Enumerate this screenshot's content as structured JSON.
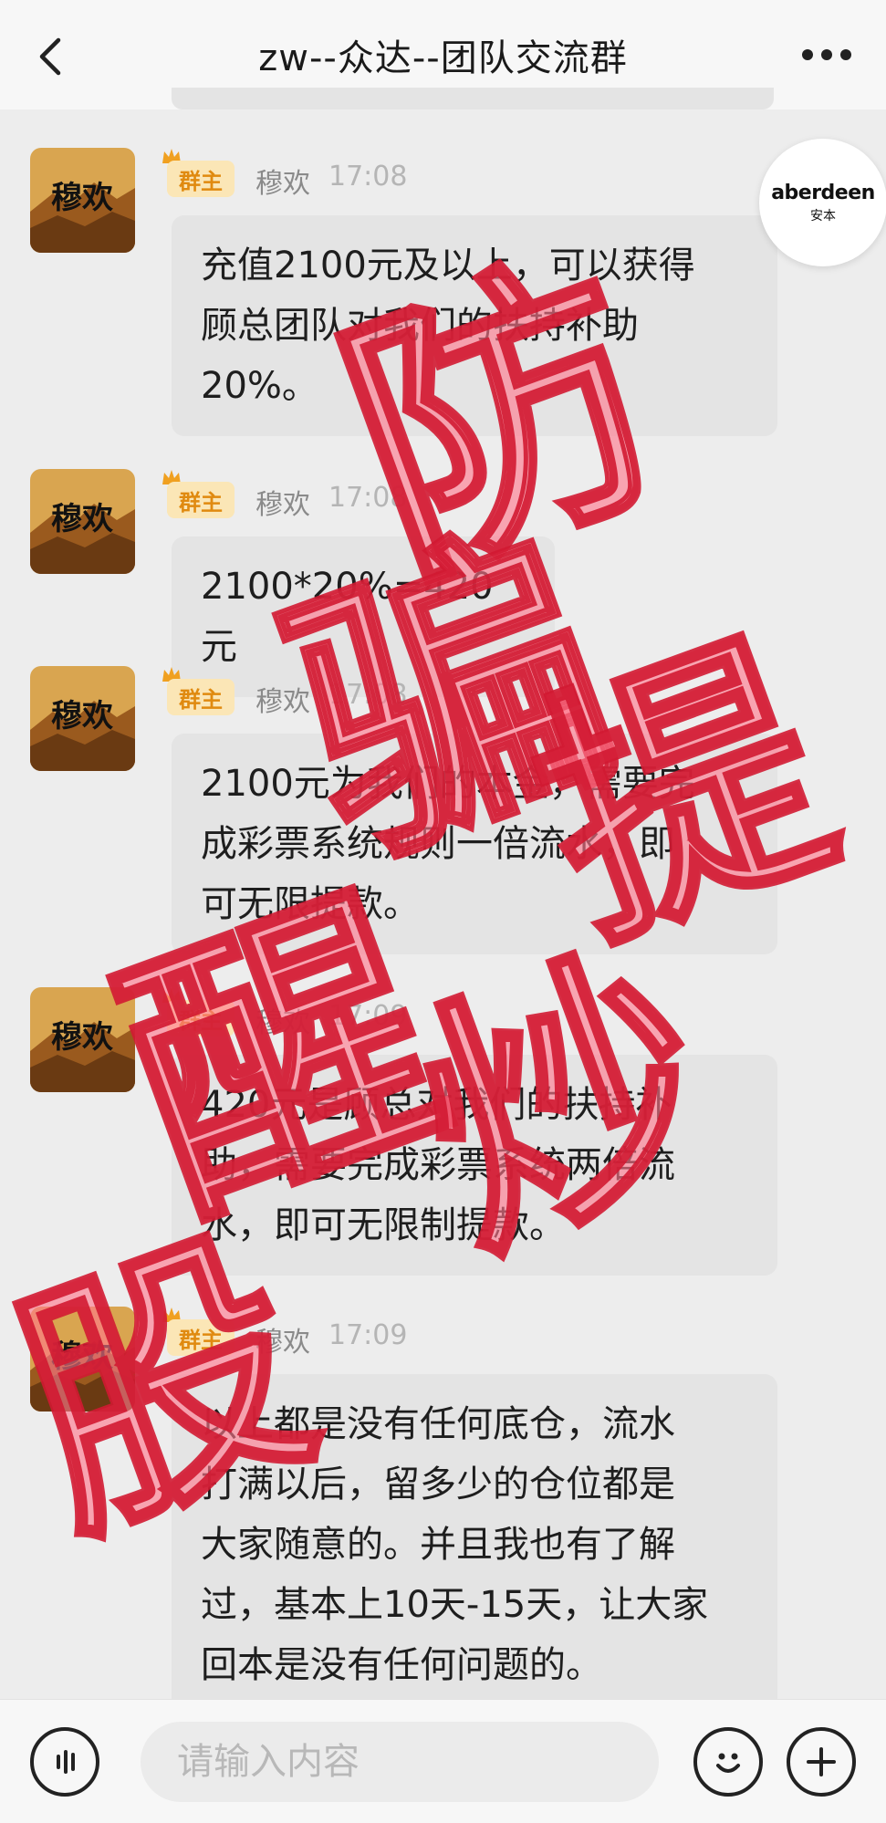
{
  "header": {
    "title": "zw--众达--团队交流群",
    "back_icon": "chevron-left-icon",
    "more_icon": "more-dots-icon"
  },
  "watermark_logo": {
    "main": "aberdeen",
    "sub": "安本"
  },
  "messages": [
    {
      "avatar_text": "穆欢",
      "role_badge": "群主",
      "sender": "穆欢",
      "time": "17:08",
      "text": "充值2100元及以上，可以获得\n顾总团队对我们的扶持补助\n20%。"
    },
    {
      "avatar_text": "穆欢",
      "role_badge": "群主",
      "sender": "穆欢",
      "time": "17:08",
      "text": "2100*20%=420元"
    },
    {
      "avatar_text": "穆欢",
      "role_badge": "群主",
      "sender": "穆欢",
      "time": "17:08",
      "text": "2100元为我们的本金，需要完\n成彩票系统规则一倍流水，即\n可无限提款。"
    },
    {
      "avatar_text": "穆欢",
      "role_badge": "群主",
      "sender": "穆欢",
      "time": "17:09",
      "text": "420元是顾总对我们的扶持补\n助，需要完成彩票系统两倍流\n水，即可无限制提款。"
    },
    {
      "avatar_text": "穆欢",
      "role_badge": "群主",
      "sender": "穆欢",
      "time": "17:09",
      "text": "以上都是没有任何底仓，流水\n打满以后，留多少的仓位都是\n大家随意的。并且我也有了解\n过，基本上10天-15天，让大家\n回本是没有任何问题的。"
    }
  ],
  "stamp_overlay": {
    "chars": [
      "防",
      "骗",
      "提",
      "醒",
      "炒",
      "股"
    ],
    "color": "#d21932"
  },
  "input_bar": {
    "placeholder": "请输入内容",
    "voice_icon": "voice-icon",
    "emoji_icon": "emoji-icon",
    "plus_icon": "plus-icon"
  }
}
